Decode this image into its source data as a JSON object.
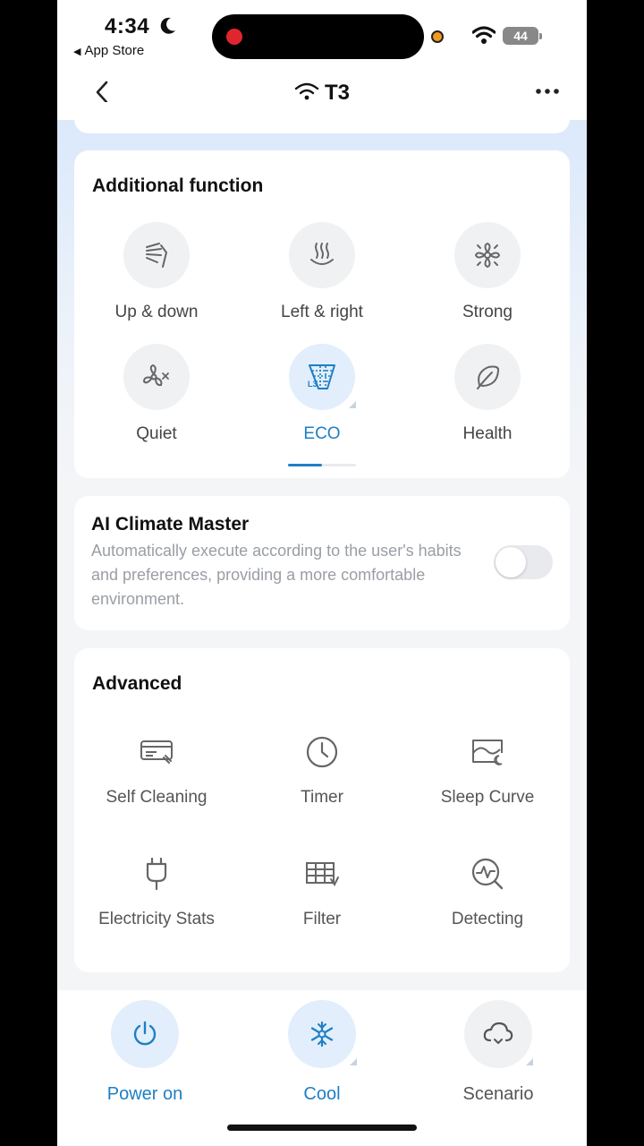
{
  "status_bar": {
    "time": "4:34",
    "back_app": "App Store",
    "battery": "44"
  },
  "nav": {
    "title": "T3"
  },
  "additional_function": {
    "title": "Additional function",
    "items": [
      {
        "label": "Up & down",
        "icon": "swing-vertical-icon",
        "active": false
      },
      {
        "label": "Left & right",
        "icon": "swing-horizontal-icon",
        "active": false
      },
      {
        "label": "Strong",
        "icon": "strong-fan-icon",
        "active": false
      },
      {
        "label": "Quiet",
        "icon": "quiet-fan-icon",
        "active": false
      },
      {
        "label": "ECO",
        "icon": "eco-icon",
        "active": true
      },
      {
        "label": "Health",
        "icon": "leaf-icon",
        "active": false
      }
    ],
    "page_index": 1,
    "page_count": 2
  },
  "ai_climate": {
    "title": "AI Climate Master",
    "description": "Automatically execute according to the user's habits and preferences, providing a more comfortable environment.",
    "enabled": false
  },
  "advanced": {
    "title": "Advanced",
    "items": [
      {
        "label": "Self Cleaning",
        "icon": "self-cleaning-icon"
      },
      {
        "label": "Timer",
        "icon": "clock-icon"
      },
      {
        "label": "Sleep Curve",
        "icon": "sleep-curve-icon"
      },
      {
        "label": "Electricity Stats",
        "icon": "plug-icon"
      },
      {
        "label": "Filter",
        "icon": "filter-icon"
      },
      {
        "label": "Detecting",
        "icon": "detecting-icon"
      }
    ]
  },
  "bottom_bar": {
    "items": [
      {
        "label": "Power on",
        "icon": "power-icon",
        "active": true
      },
      {
        "label": "Cool",
        "icon": "snowflake-icon",
        "active": true
      },
      {
        "label": "Scenario",
        "icon": "cloud-icon",
        "active": false
      }
    ]
  },
  "colors": {
    "accent": "#1e7fc4",
    "active_circle": "#e2eefb",
    "inactive_circle": "#f0f1f3"
  }
}
